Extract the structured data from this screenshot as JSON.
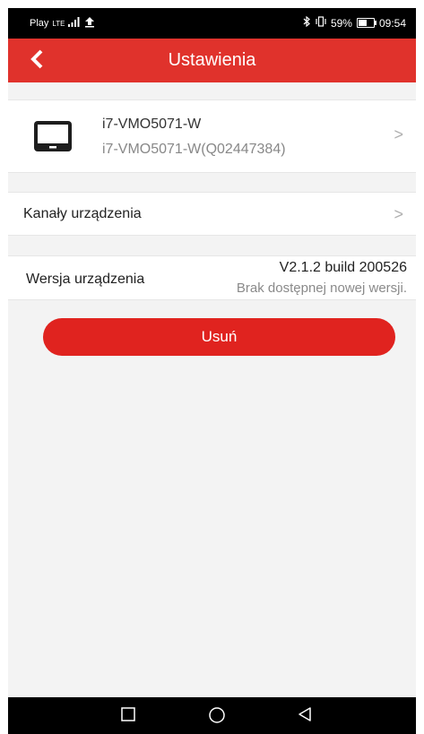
{
  "status_bar": {
    "carrier": "Play",
    "network": "LTE",
    "battery_percent": "59%",
    "battery_level": 0.59,
    "time": "09:54",
    "icons": [
      "signal-icon",
      "upload-icon",
      "bluetooth-icon",
      "vibrate-icon",
      "battery-icon"
    ]
  },
  "app_bar": {
    "title": "Ustawienia",
    "back_icon": "chevron-left-icon"
  },
  "device": {
    "name": "i7-VMO5071-W",
    "serial": "i7-VMO5071-W(Q02447384)",
    "icon": "monitor-icon"
  },
  "channels": {
    "label": "Kanały urządzenia"
  },
  "version": {
    "label": "Wersja urządzenia",
    "value": "V2.1.2 build 200526",
    "status": "Brak dostępnej nowej wersji."
  },
  "actions": {
    "delete_label": "Usuń"
  },
  "chevron": ">",
  "colors": {
    "accent": "#e0322c",
    "button": "#e0231f",
    "background": "#f3f3f3"
  }
}
